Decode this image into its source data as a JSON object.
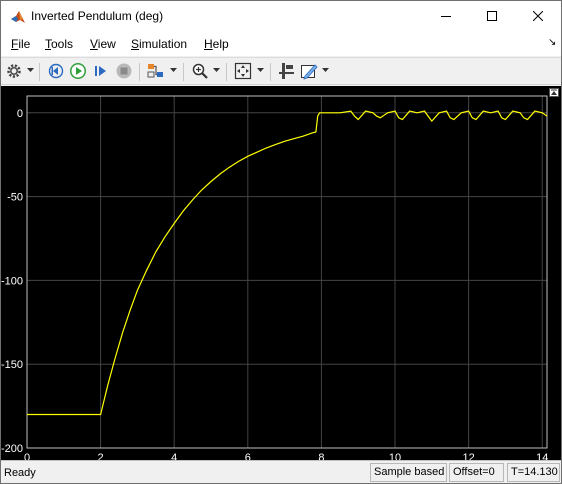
{
  "window": {
    "title": "Inverted Pendulum (deg)"
  },
  "menu": {
    "items": [
      "File",
      "Tools",
      "View",
      "Simulation",
      "Help"
    ]
  },
  "toolbar": {
    "icons": [
      "settings-icon",
      "step-back-icon",
      "run-icon",
      "step-forward-icon",
      "stop-icon",
      "highlight-icon",
      "zoom-icon",
      "fit-to-view-icon",
      "cursor-measure-icon",
      "edit-style-icon"
    ]
  },
  "colors": {
    "plot_background": "#000000",
    "signal": "#ffff00",
    "grid": "#444444",
    "axes": "#c0c0c0"
  },
  "chart_data": {
    "type": "line",
    "title": "",
    "xlabel": "",
    "ylabel": "",
    "xlim": [
      0,
      14.13
    ],
    "ylim": [
      -200,
      10
    ],
    "x_ticks": [
      0,
      2,
      4,
      6,
      8,
      10,
      12,
      14
    ],
    "y_ticks": [
      0,
      -50,
      -100,
      -150,
      -200
    ],
    "x_tick_labels": [
      "0",
      "2",
      "4",
      "6",
      "8",
      "10",
      "12",
      "14"
    ],
    "y_tick_labels": [
      "0",
      "-50",
      "-100",
      "-150",
      "-200"
    ],
    "grid": true,
    "series": [
      {
        "color": "#ffff00",
        "x": [
          0,
          2.0,
          2.1,
          2.2,
          2.4,
          2.6,
          2.8,
          3.0,
          3.25,
          3.5,
          3.75,
          4.0,
          4.25,
          4.5,
          4.75,
          5.0,
          5.25,
          5.5,
          5.75,
          6.0,
          6.25,
          6.5,
          6.75,
          7.0,
          7.25,
          7.5,
          7.75,
          7.85,
          7.9,
          7.95,
          8.2,
          8.5,
          8.8,
          8.9,
          9.0,
          9.2,
          9.4,
          9.5,
          9.6,
          9.8,
          10.0,
          10.1,
          10.2,
          10.4,
          10.6,
          10.8,
          10.9,
          11.0,
          11.2,
          11.4,
          11.5,
          11.6,
          11.8,
          12.0,
          12.1,
          12.2,
          12.4,
          12.6,
          12.8,
          12.9,
          13.0,
          13.2,
          13.4,
          13.5,
          13.6,
          13.8,
          14.0,
          14.13
        ],
        "y": [
          -180,
          -180,
          -171,
          -162,
          -146,
          -131,
          -118,
          -106,
          -94,
          -83,
          -74,
          -66,
          -58.5,
          -52,
          -46,
          -41,
          -36.5,
          -32.5,
          -29,
          -26,
          -23.5,
          -21,
          -19,
          -17,
          -15.5,
          -14,
          -12,
          -11.5,
          -2,
          0,
          0,
          0,
          1,
          -2,
          -4,
          1,
          0,
          -2,
          -3,
          0,
          1,
          -3,
          -4,
          1,
          0,
          1,
          -2,
          -5,
          0,
          1,
          -3,
          -4,
          0,
          1,
          -3,
          -4,
          1,
          0,
          1,
          -3,
          -4,
          1,
          0,
          -3,
          -4,
          1,
          0,
          -2
        ]
      }
    ]
  },
  "status": {
    "ready": "Ready",
    "sample": "Sample based",
    "offset": "Offset=0",
    "time": "T=14.130"
  }
}
